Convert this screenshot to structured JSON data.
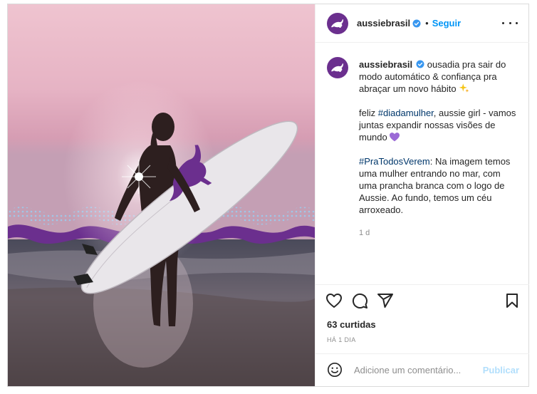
{
  "post": {
    "username": "aussiebrasil",
    "follow_label": "Seguir",
    "separator": "•",
    "caption": {
      "line1": "ousadia pra sair do modo automático & confiança pra abraçar um novo hábito",
      "line2_prefix": "feliz ",
      "line2_hashtag": "#diadamulher",
      "line2_rest": ", aussie girl - vamos juntas expandir nossas visões de mundo",
      "line3_hashtag": "#PraTodosVerem",
      "line3_rest": ": Na imagem temos uma mulher entrando no mar, com uma prancha branca com o logo de Aussie. Ao fundo, temos um céu arroxeado."
    },
    "relative_time": "1 d",
    "likes": "63 curtidas",
    "date": "HÁ 1 DIA",
    "comment_placeholder": "Adicione um comentário...",
    "publish_label": "Publicar"
  },
  "colors": {
    "brand_purple": "#6b2f8e",
    "link_blue": "#0095f6",
    "hashtag_blue": "#00376b",
    "verified_blue": "#3897f0"
  },
  "icons": [
    "verified-icon",
    "more-options-icon",
    "heart-icon",
    "comment-icon",
    "share-icon",
    "bookmark-icon",
    "emoji-icon",
    "kangaroo-logo-icon"
  ]
}
